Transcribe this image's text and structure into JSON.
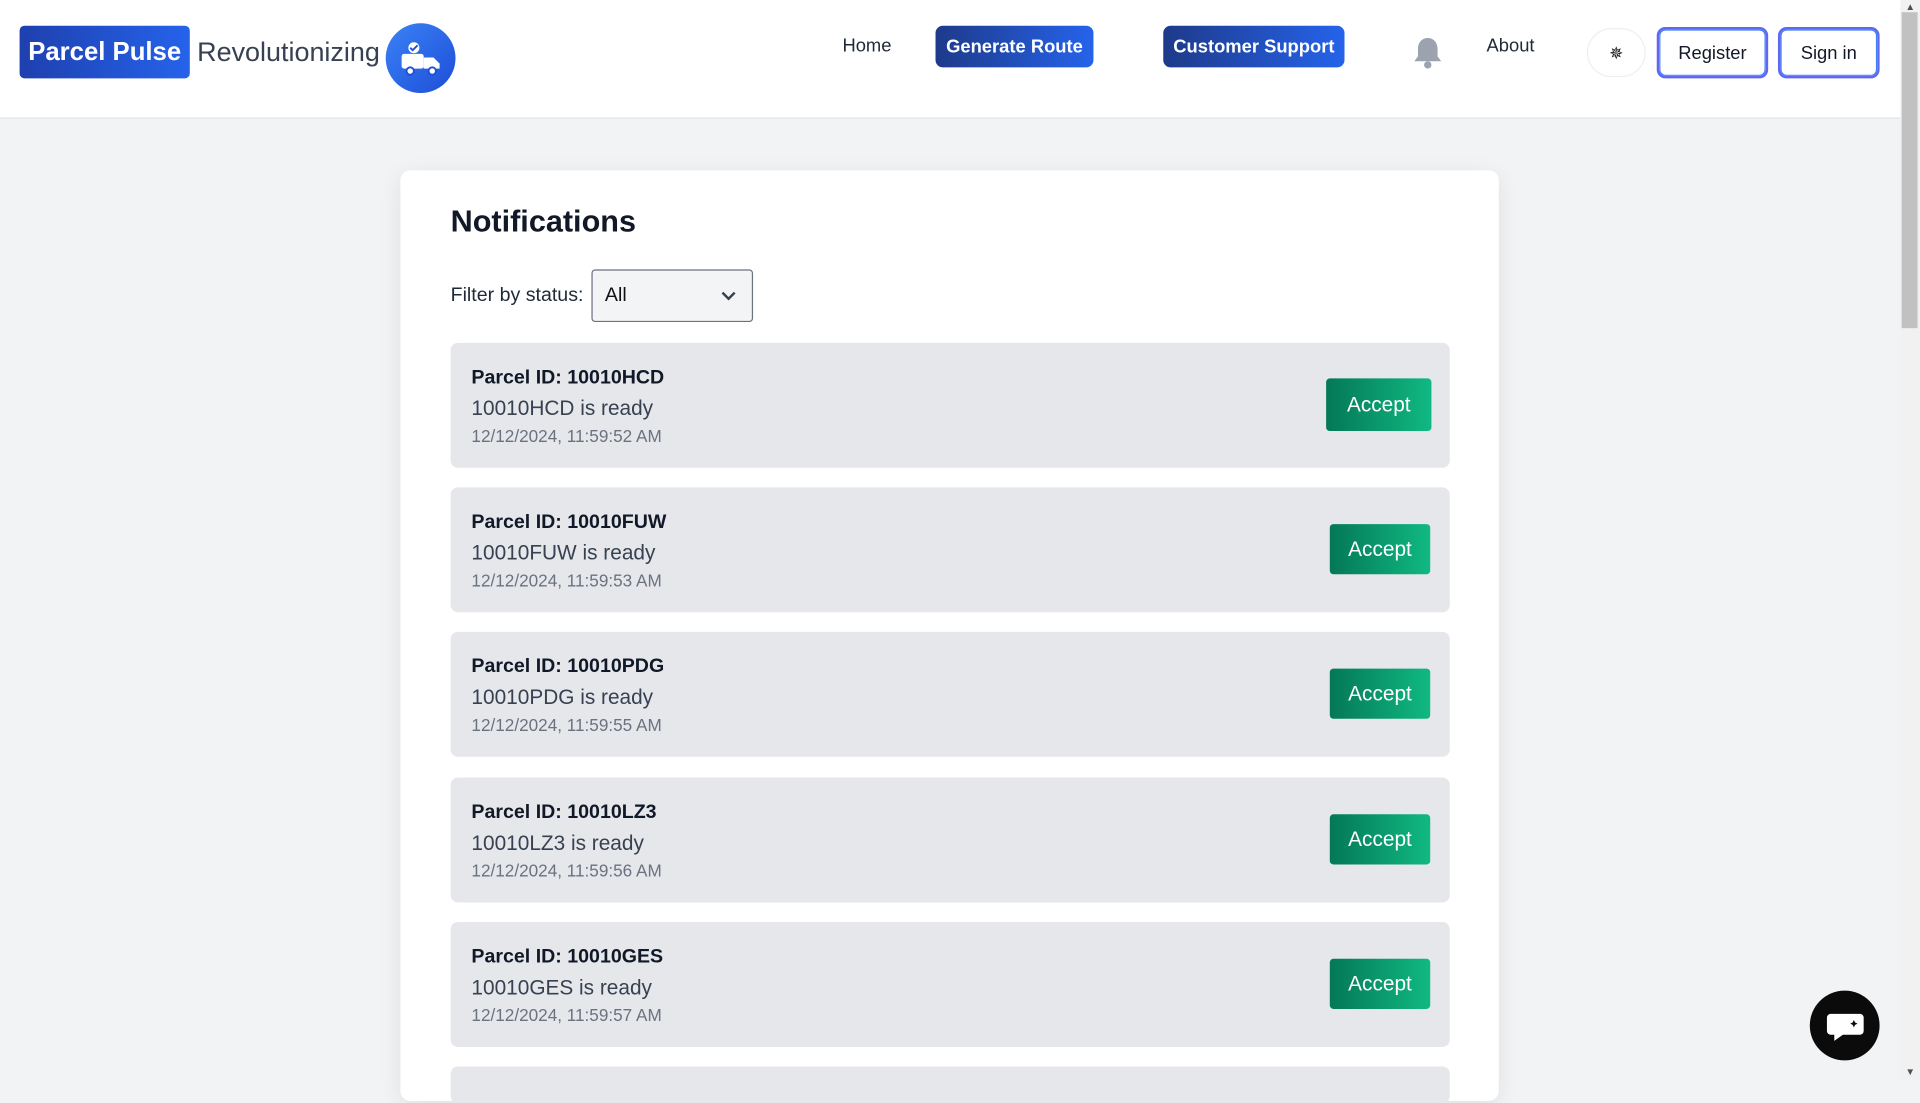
{
  "header": {
    "brand": "Parcel Pulse",
    "tagline": "Revolutionizing",
    "nav": {
      "home": "Home",
      "generate_route": "Generate Route",
      "customer_support": "Customer Support",
      "about": "About"
    },
    "theme_toggle_glyph": "✵",
    "register": "Register",
    "sign_in": "Sign in"
  },
  "notifications": {
    "title": "Notifications",
    "filter_label": "Filter by status:",
    "filter_value": "All",
    "accept_label": "Accept",
    "items": [
      {
        "parcel_id": "Parcel ID: 10010HCD",
        "message": "10010HCD is ready",
        "timestamp": "12/12/2024, 11:59:52 AM"
      },
      {
        "parcel_id": "Parcel ID: 10010FUW",
        "message": "10010FUW is ready",
        "timestamp": "12/12/2024, 11:59:53 AM"
      },
      {
        "parcel_id": "Parcel ID: 10010PDG",
        "message": "10010PDG is ready",
        "timestamp": "12/12/2024, 11:59:55 AM"
      },
      {
        "parcel_id": "Parcel ID: 10010LZ3",
        "message": "10010LZ3 is ready",
        "timestamp": "12/12/2024, 11:59:56 AM"
      },
      {
        "parcel_id": "Parcel ID: 10010GES",
        "message": "10010GES is ready",
        "timestamp": "12/12/2024, 11:59:57 AM"
      }
    ]
  },
  "colors": {
    "brand_blue": "#1e40af",
    "accept_green": "#047857",
    "card_bg": "#ffffff",
    "notif_bg": "#e5e7eb"
  }
}
